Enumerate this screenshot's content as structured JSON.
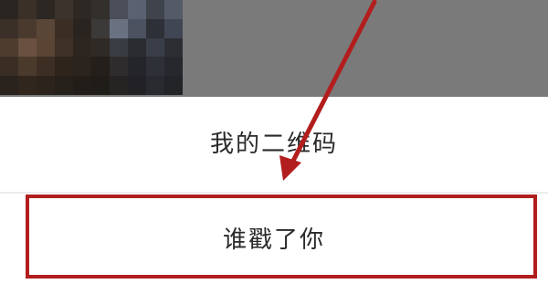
{
  "sheet": {
    "items": [
      {
        "label": "我的二维码"
      },
      {
        "label": "谁戳了你"
      }
    ]
  },
  "annotation": {
    "color": "#b21e1e",
    "arrow_icon": "arrow-icon"
  },
  "top_area": {
    "color": "#7a7a7a"
  }
}
